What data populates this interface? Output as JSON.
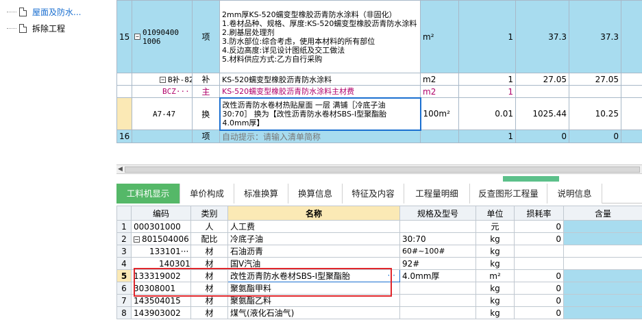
{
  "tree": {
    "items": [
      {
        "label": "屋面及防水..."
      },
      {
        "label": "拆除工程"
      }
    ]
  },
  "upper": {
    "rows": [
      {
        "index": "15",
        "code": "01090400\n1006",
        "type": "项",
        "name_lines": [
          "2mm厚KS-520蠕变型橡胶沥青防水涂料（非固化）",
          "1.卷材品种、规格、厚度:KS-520蠕变型橡胶沥青防水涂料",
          "2.刷基层处理剂",
          "3.防水部位:综合考虑，使用本材料的所有部位",
          "4.反边高度:详见设计图纸及交工做法",
          "5.材料供应方式:乙方自行采购"
        ],
        "unit": "m²",
        "qty": "1",
        "price": "37.3",
        "total": "37.3"
      },
      {
        "code": "B补-82",
        "type": "补",
        "name": "KS-520蠕变型橡胶沥青防水涂料",
        "unit": "m2",
        "qty": "1",
        "price": "27.05",
        "total": "27.05"
      },
      {
        "code": "BCZ···",
        "type": "主",
        "name": "KS-520蠕变型橡胶沥青防水涂料主材费",
        "unit": "m2",
        "qty": "1",
        "price": "",
        "total": ""
      },
      {
        "code": "A7-47",
        "type": "换",
        "name_lines": [
          "改性沥青防水卷材热贴屋面 一层 满铺［冷底子油",
          "30:70］  换为【改性沥青防水卷材SBS-Ⅰ型聚酯胎",
          "4.0mm厚】"
        ],
        "unit": "100m²",
        "qty": "0.01",
        "price": "1025.44",
        "total": "10.25"
      },
      {
        "index": "16",
        "type": "项",
        "name": "自动提示：请输入清单简称",
        "qty": "1",
        "price": "0",
        "total": "0"
      }
    ]
  },
  "tabs": [
    "工料机显示",
    "单价构成",
    "标准换算",
    "换算信息",
    "特征及内容",
    "工程量明细",
    "反查图形工程量",
    "说明信息"
  ],
  "lower": {
    "headers": [
      "编码",
      "类别",
      "名称",
      "规格及型号",
      "单位",
      "损耗率",
      "含量"
    ],
    "rows": [
      {
        "n": "1",
        "code": "000301000",
        "cat": "人",
        "name": "人工费",
        "spec": "",
        "unit": "元",
        "loss": "0"
      },
      {
        "n": "2",
        "code": "801504006",
        "cat": "配比",
        "name": "冷底子油",
        "spec": "30:70",
        "unit": "kg",
        "loss": "0"
      },
      {
        "n": "3",
        "code": "133101···",
        "cat": "材",
        "name": "石油沥青",
        "spec": "60#~100#",
        "unit": "kg",
        "loss": ""
      },
      {
        "n": "4",
        "code": "140301",
        "cat": "材",
        "name": "国Ⅴ汽油",
        "spec": "92#",
        "unit": "kg",
        "loss": ""
      },
      {
        "n": "5",
        "code": "133319002",
        "cat": "材",
        "name": "改性沥青防水卷材SBS-Ⅰ型聚酯胎",
        "spec": "4.0mm厚",
        "unit": "m²",
        "loss": "0"
      },
      {
        "n": "6",
        "code": "30308001",
        "cat": "材",
        "name": "聚氨酯甲料",
        "spec": "",
        "unit": "kg",
        "loss": "0"
      },
      {
        "n": "7",
        "code": "143504015",
        "cat": "材",
        "name": "聚氨酯乙料",
        "spec": "",
        "unit": "kg",
        "loss": "0"
      },
      {
        "n": "8",
        "code": "143903002",
        "cat": "材",
        "name": "煤气(液化石油气)",
        "spec": "",
        "unit": "kg",
        "loss": "0"
      }
    ]
  },
  "colors": {
    "accent_tab": "#55b868",
    "selected_row": "#a8dcef",
    "highlight_box": "#e0262b"
  }
}
